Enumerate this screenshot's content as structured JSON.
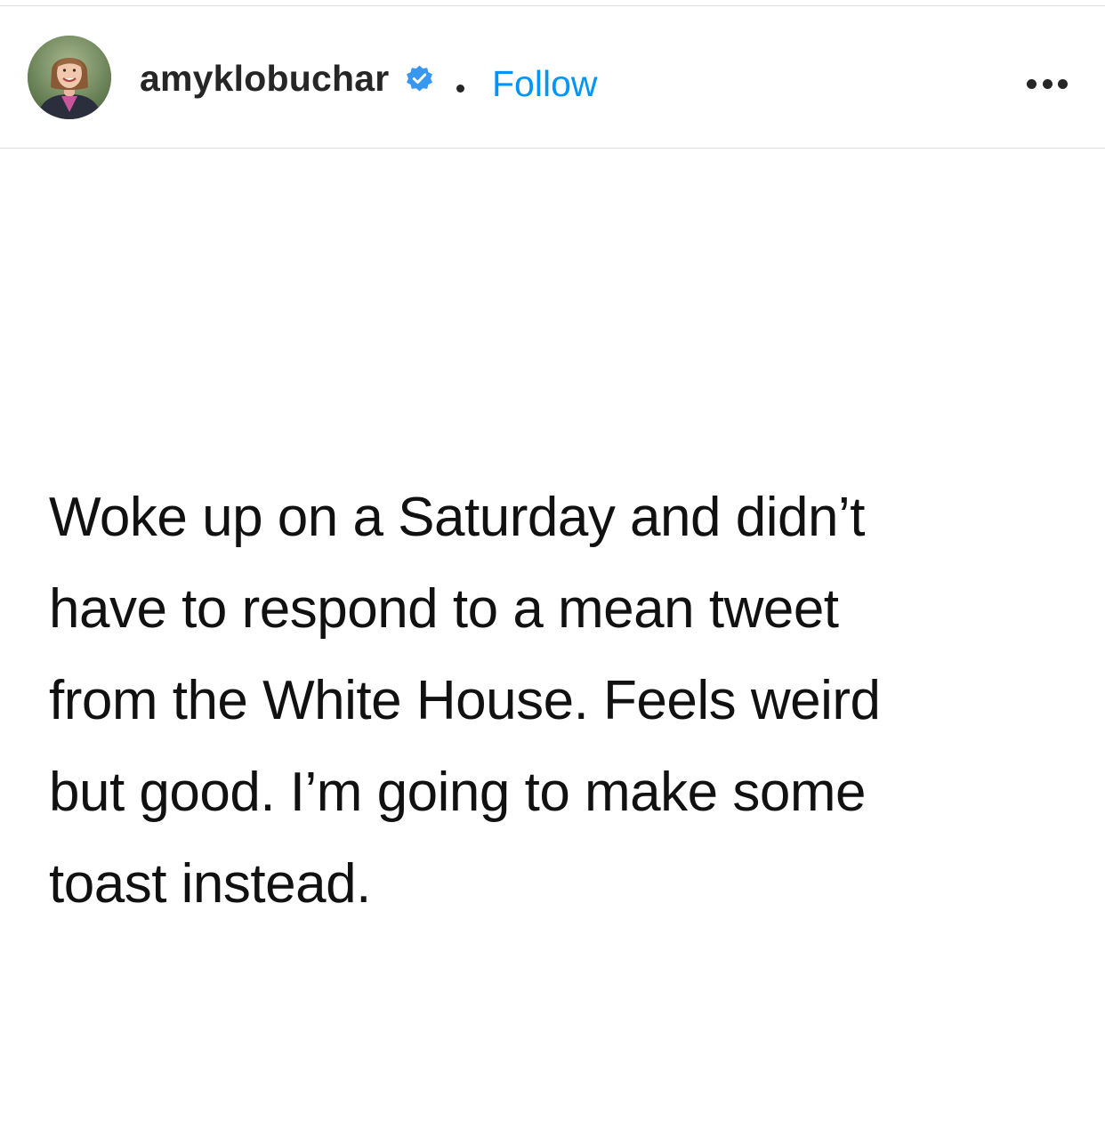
{
  "post_header": {
    "username": "amyklobuchar",
    "verified_icon": "verified-badge-icon",
    "separator": "•",
    "follow_label": "Follow",
    "more_icon": "more-options-icon",
    "colors": {
      "follow": "#0095f6",
      "verified": "#3897f0",
      "text": "#262626",
      "divider": "#dbdbdb"
    }
  },
  "post": {
    "lines": [
      "Woke up on a Saturday and didn’t",
      "have to respond to a mean tweet",
      "from the White House. Feels weird",
      "but good. I’m going to make some",
      "toast instead."
    ]
  }
}
